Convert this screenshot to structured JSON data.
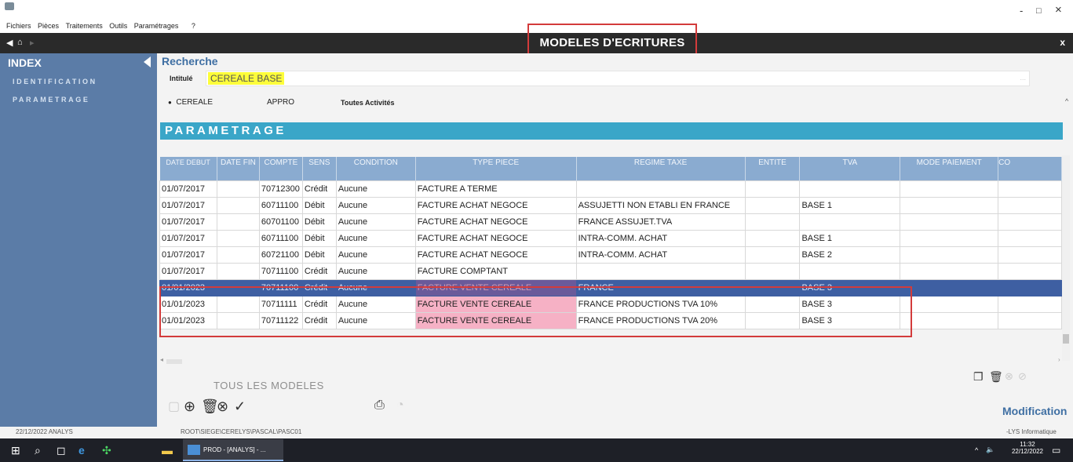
{
  "window": {
    "minimize": "-",
    "maximize": "□",
    "close": "×"
  },
  "menu": [
    "Fichiers",
    "Pièces",
    "Traitements",
    "Outils",
    "Paramétrages",
    "?"
  ],
  "header": {
    "title": "MODELES D'ECRITURES",
    "close": "x"
  },
  "sidebar": {
    "title": "INDEX",
    "items": [
      "IDENTIFICATION",
      "PARAMETRAGE"
    ]
  },
  "search": {
    "title": "Recherche",
    "label": "Intitulé",
    "value": "CEREALE BASE"
  },
  "activities": {
    "selected": "CEREALE",
    "options": [
      "CEREALE",
      "APPRO",
      "Toutes Activités"
    ]
  },
  "section_title": "PARAMETRAGE",
  "table": {
    "columns": [
      "DATE DEBUT",
      "DATE FIN",
      "COMPTE",
      "SENS",
      "CONDITION",
      "TYPE PIECE",
      "REGIME TAXE",
      "ENTITE",
      "TVA",
      "MODE PAIEMENT",
      "CO"
    ],
    "rows": [
      [
        "01/07/2017",
        "",
        "70712300",
        "Crédit",
        "Aucune",
        "FACTURE A TERME",
        "",
        "",
        "",
        "",
        ""
      ],
      [
        "01/07/2017",
        "",
        "60711100",
        "Débit",
        "Aucune",
        "FACTURE ACHAT NEGOCE",
        "ASSUJETTI NON ETABLI EN FRANCE",
        "",
        "BASE 1",
        "",
        ""
      ],
      [
        "01/07/2017",
        "",
        "60701100",
        "Débit",
        "Aucune",
        "FACTURE ACHAT NEGOCE",
        "FRANCE ASSUJET.TVA",
        "",
        "",
        "",
        ""
      ],
      [
        "01/07/2017",
        "",
        "60711100",
        "Débit",
        "Aucune",
        "FACTURE ACHAT NEGOCE",
        "INTRA-COMM. ACHAT",
        "",
        "BASE 1",
        "",
        ""
      ],
      [
        "01/07/2017",
        "",
        "60721100",
        "Débit",
        "Aucune",
        "FACTURE ACHAT NEGOCE",
        "INTRA-COMM. ACHAT",
        "",
        "BASE 2",
        "",
        ""
      ],
      [
        "01/07/2017",
        "",
        "70711100",
        "Crédit",
        "Aucune",
        "FACTURE COMPTANT",
        "",
        "",
        "",
        "",
        ""
      ],
      [
        "01/01/2023",
        "",
        "70711100",
        "Crédit",
        "Aucune",
        "FACTURE VENTE CEREALE",
        "FRANCE",
        "",
        "BASE 3",
        "",
        ""
      ],
      [
        "01/01/2023",
        "",
        "70711111",
        "Crédit",
        "Aucune",
        "FACTURE VENTE CEREALE",
        "FRANCE PRODUCTIONS TVA 10%",
        "",
        "BASE 3",
        "",
        ""
      ],
      [
        "01/01/2023",
        "",
        "70711122",
        "Crédit",
        "Aucune",
        "FACTURE VENTE CEREALE",
        "FRANCE PRODUCTIONS TVA 20%",
        "",
        "BASE 3",
        "",
        ""
      ]
    ],
    "selected_row": 6
  },
  "footer": {
    "tous_les_modeles": "TOUS LES MODELES",
    "mode": "Modification"
  },
  "status": {
    "date_user": "22/12/2022   ANALYS",
    "path": "ROOT\\SIEGE\\CERELYS\\PASCAL\\PASC01",
    "vendor": "-LYS Informatique"
  },
  "taskbar": {
    "app_label": "PROD - [ANALYS] - ...",
    "time": "11:32",
    "date": "22/12/2022"
  },
  "colors": {
    "accent_blue": "#5b7ca7",
    "section_bar": "#3aa6c8",
    "selected_row": "#3e5fa2",
    "highlight_yellow": "#fdfd3a",
    "highlight_pink": "#f6b1c5",
    "annotation_red": "#d33b3b"
  }
}
